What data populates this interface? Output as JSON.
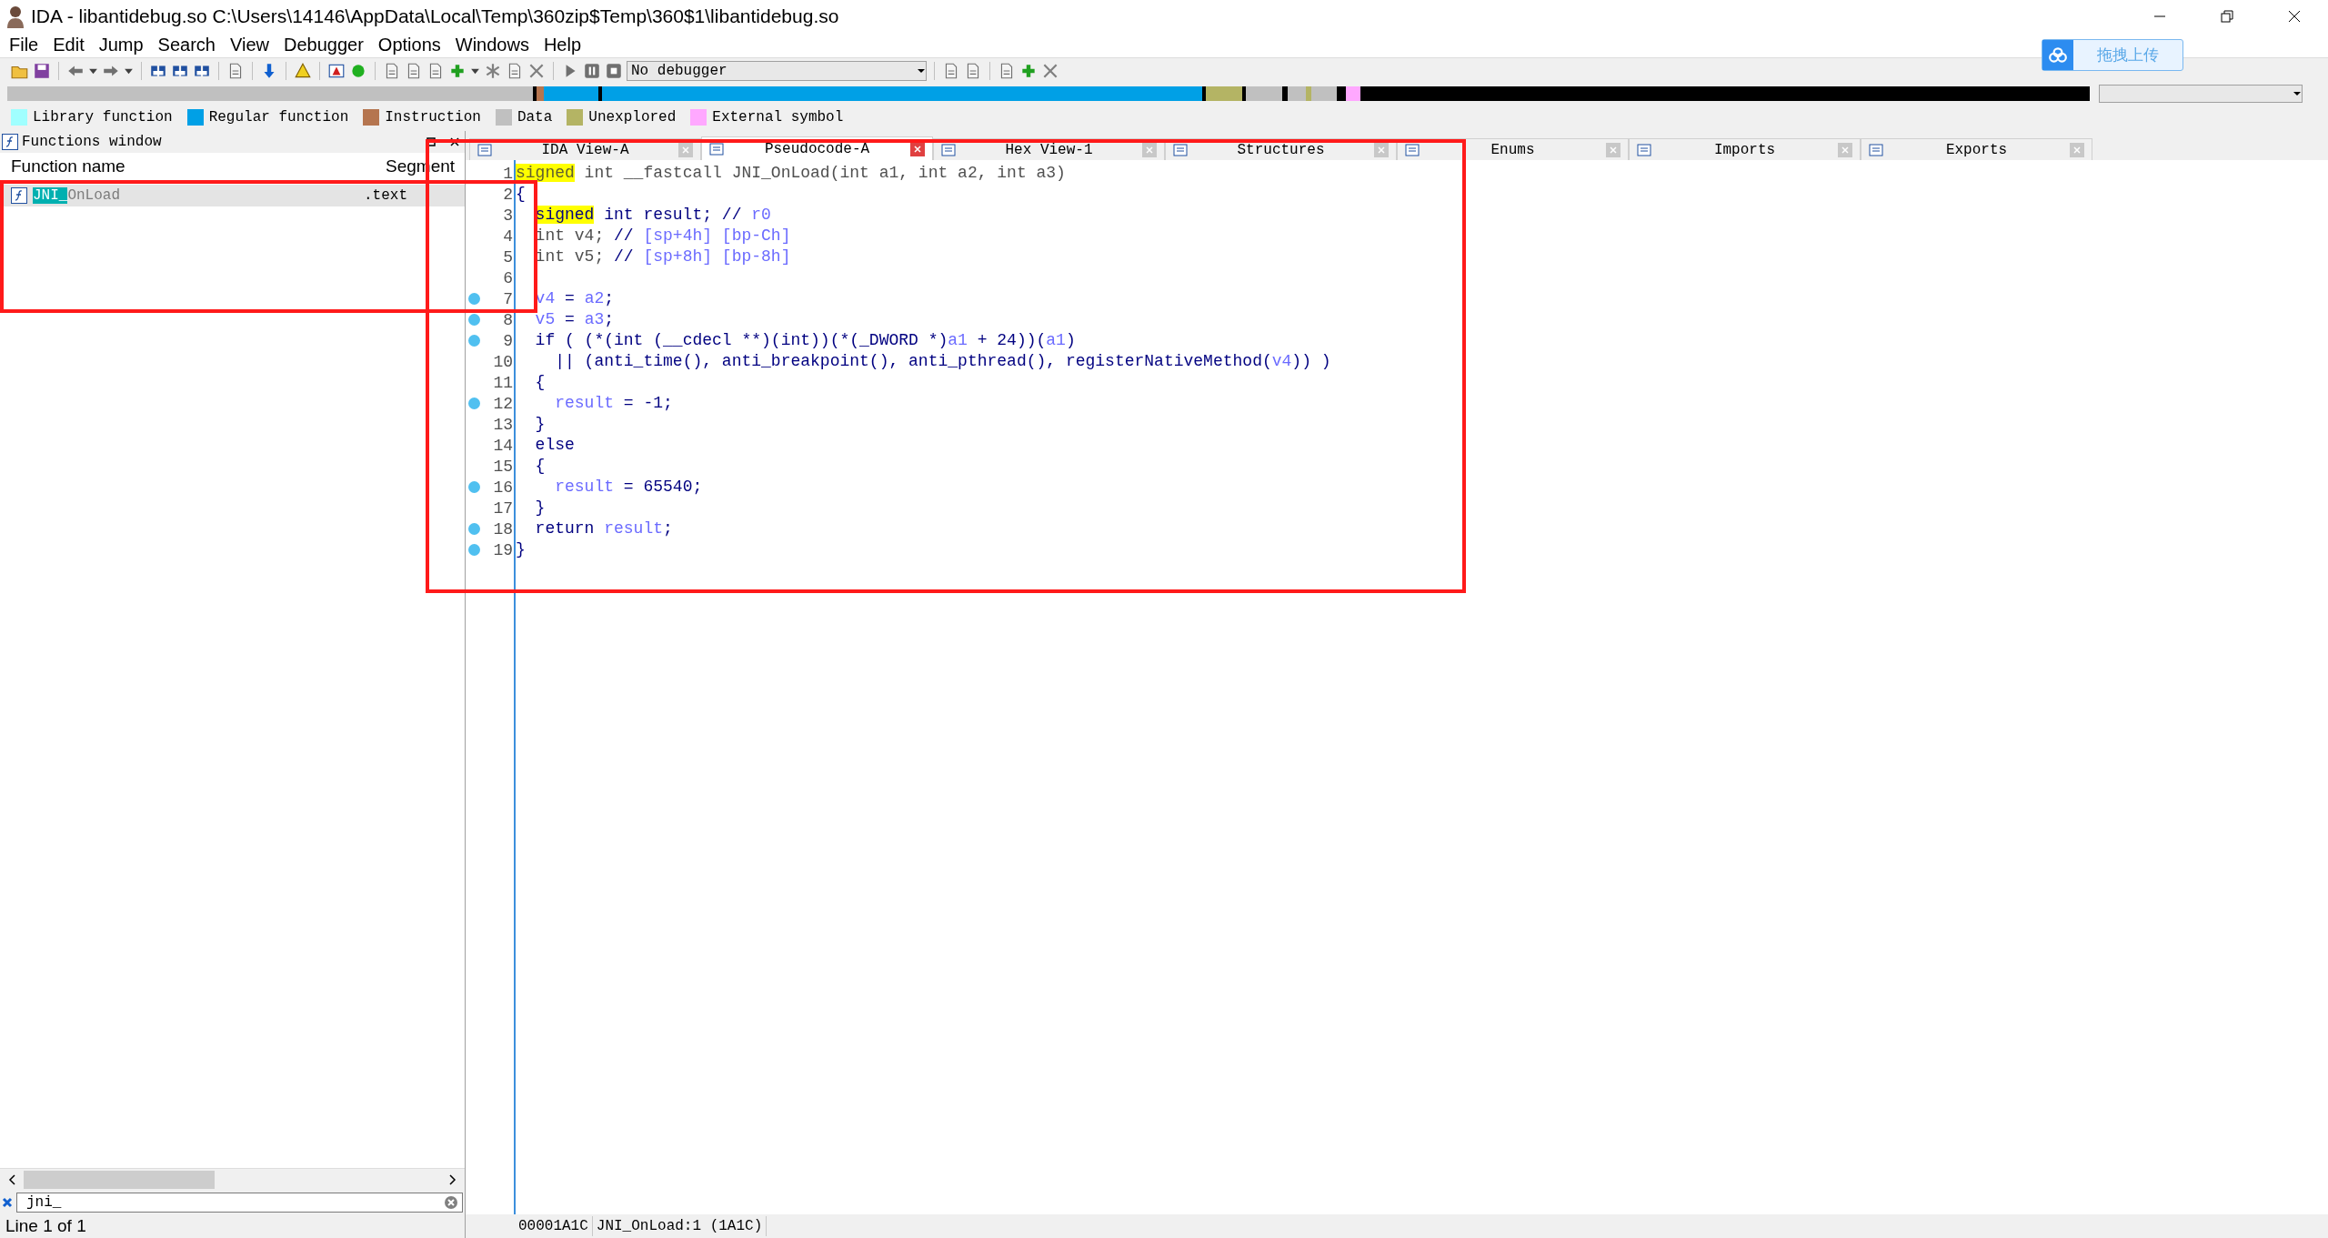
{
  "window": {
    "title": "IDA - libantidebug.so C:\\Users\\14146\\AppData\\Local\\Temp\\360zip$Temp\\360$1\\libantidebug.so"
  },
  "menu": [
    "File",
    "Edit",
    "Jump",
    "Search",
    "View",
    "Debugger",
    "Options",
    "Windows",
    "Help"
  ],
  "upload_button": {
    "label": "拖拽上传"
  },
  "toolbar": {
    "debugger_select": "No debugger"
  },
  "legend": [
    {
      "label": "Library function",
      "color": "#a0ffff"
    },
    {
      "label": "Regular function",
      "color": "#00a0e6"
    },
    {
      "label": "Instruction",
      "color": "#b5754f"
    },
    {
      "label": "Data",
      "color": "#c0c0c0"
    },
    {
      "label": "Unexplored",
      "color": "#b4b464"
    },
    {
      "label": "External symbol",
      "color": "#ffa8ff"
    }
  ],
  "functions_window": {
    "title": "Functions window",
    "columns": [
      "Function name",
      "Segment"
    ],
    "rows": [
      {
        "match": "JNI_",
        "rest": "OnLoad",
        "segment": ".text",
        "selected": true
      }
    ],
    "filter": "jni_",
    "status": "Line 1 of 1"
  },
  "tabs": [
    {
      "label": "IDA View-A",
      "selected": false
    },
    {
      "label": "Pseudocode-A",
      "selected": true
    },
    {
      "label": "Hex View-1",
      "selected": false
    },
    {
      "label": "Structures",
      "selected": false
    },
    {
      "label": "Enums",
      "selected": false
    },
    {
      "label": "Imports",
      "selected": false
    },
    {
      "label": "Exports",
      "selected": false
    }
  ],
  "code": {
    "lines": [
      {
        "number": "1",
        "dot": false,
        "segments": [
          {
            "kind": "mark_dim",
            "text": "signed"
          },
          {
            "kind": "dim",
            "text": " int __fastcall JNI_OnLoad(int a1, int a2, int a3)"
          }
        ]
      },
      {
        "number": "2",
        "dot": false,
        "segments": [
          {
            "kind": "kw",
            "text": "{"
          }
        ]
      },
      {
        "number": "3",
        "dot": false,
        "indented": true,
        "segments": [
          {
            "kind": "mark",
            "text": "signed"
          },
          {
            "kind": "kw",
            "text": " int result; // "
          },
          {
            "kind": "var",
            "text": "r0"
          }
        ]
      },
      {
        "number": "4",
        "dot": false,
        "segments": [
          {
            "kind": "dim",
            "text": "  int v4; "
          },
          {
            "kind": "kw",
            "text": "// "
          },
          {
            "kind": "var",
            "text": "[sp+4h] [bp-Ch]"
          }
        ]
      },
      {
        "number": "5",
        "dot": false,
        "segments": [
          {
            "kind": "dim",
            "text": "  int v5; "
          },
          {
            "kind": "kw",
            "text": "// "
          },
          {
            "kind": "var",
            "text": "[sp+8h] [bp-8h]"
          }
        ]
      },
      {
        "number": "6",
        "dot": false
      },
      {
        "number": "7",
        "dot": true,
        "segments": [
          {
            "kind": "var",
            "text": "  v4"
          },
          {
            "kind": "kw",
            "text": " = "
          },
          {
            "kind": "var",
            "text": "a2"
          },
          {
            "kind": "kw",
            "text": ";"
          }
        ]
      },
      {
        "number": "8",
        "dot": true,
        "segments": [
          {
            "kind": "var",
            "text": "  v5"
          },
          {
            "kind": "kw",
            "text": " = "
          },
          {
            "kind": "var",
            "text": "a3"
          },
          {
            "kind": "kw",
            "text": ";"
          }
        ]
      },
      {
        "number": "9",
        "dot": true,
        "segments": [
          {
            "kind": "kw",
            "text": "  if ( (*(int (__cdecl **)(int))(*(_DWORD *)"
          },
          {
            "kind": "var",
            "text": "a1"
          },
          {
            "kind": "kw",
            "text": " + 24))("
          },
          {
            "kind": "var",
            "text": "a1"
          },
          {
            "kind": "kw",
            "text": ")"
          }
        ]
      },
      {
        "number": "10",
        "dot": false,
        "segments": [
          {
            "kind": "kw",
            "text": "    || (anti_time(), anti_breakpoint(), anti_pthread(), registerNativeMethod("
          },
          {
            "kind": "var",
            "text": "v4"
          },
          {
            "kind": "kw",
            "text": ")) )"
          }
        ]
      },
      {
        "number": "11",
        "dot": false,
        "segments": [
          {
            "kind": "kw",
            "text": "  {"
          }
        ]
      },
      {
        "number": "12",
        "dot": true,
        "segments": [
          {
            "kind": "var",
            "text": "    result"
          },
          {
            "kind": "kw",
            "text": " = -1;"
          }
        ]
      },
      {
        "number": "13",
        "dot": false,
        "segments": [
          {
            "kind": "kw",
            "text": "  }"
          }
        ]
      },
      {
        "number": "14",
        "dot": false,
        "segments": [
          {
            "kind": "kw",
            "text": "  else"
          }
        ]
      },
      {
        "number": "15",
        "dot": false,
        "segments": [
          {
            "kind": "kw",
            "text": "  {"
          }
        ]
      },
      {
        "number": "16",
        "dot": true,
        "segments": [
          {
            "kind": "var",
            "text": "    result"
          },
          {
            "kind": "kw",
            "text": " = 65540;"
          }
        ]
      },
      {
        "number": "17",
        "dot": false,
        "segments": [
          {
            "kind": "kw",
            "text": "  }"
          }
        ]
      },
      {
        "number": "18",
        "dot": true,
        "segments": [
          {
            "kind": "kw",
            "text": "  return "
          },
          {
            "kind": "var",
            "text": "result"
          },
          {
            "kind": "kw",
            "text": ";"
          }
        ]
      },
      {
        "number": "19",
        "dot": true,
        "segments": [
          {
            "kind": "kw",
            "text": "}"
          }
        ]
      }
    ]
  },
  "status_bar": [
    "00001A1C",
    "JNI_OnLoad:1 (1A1C)"
  ]
}
